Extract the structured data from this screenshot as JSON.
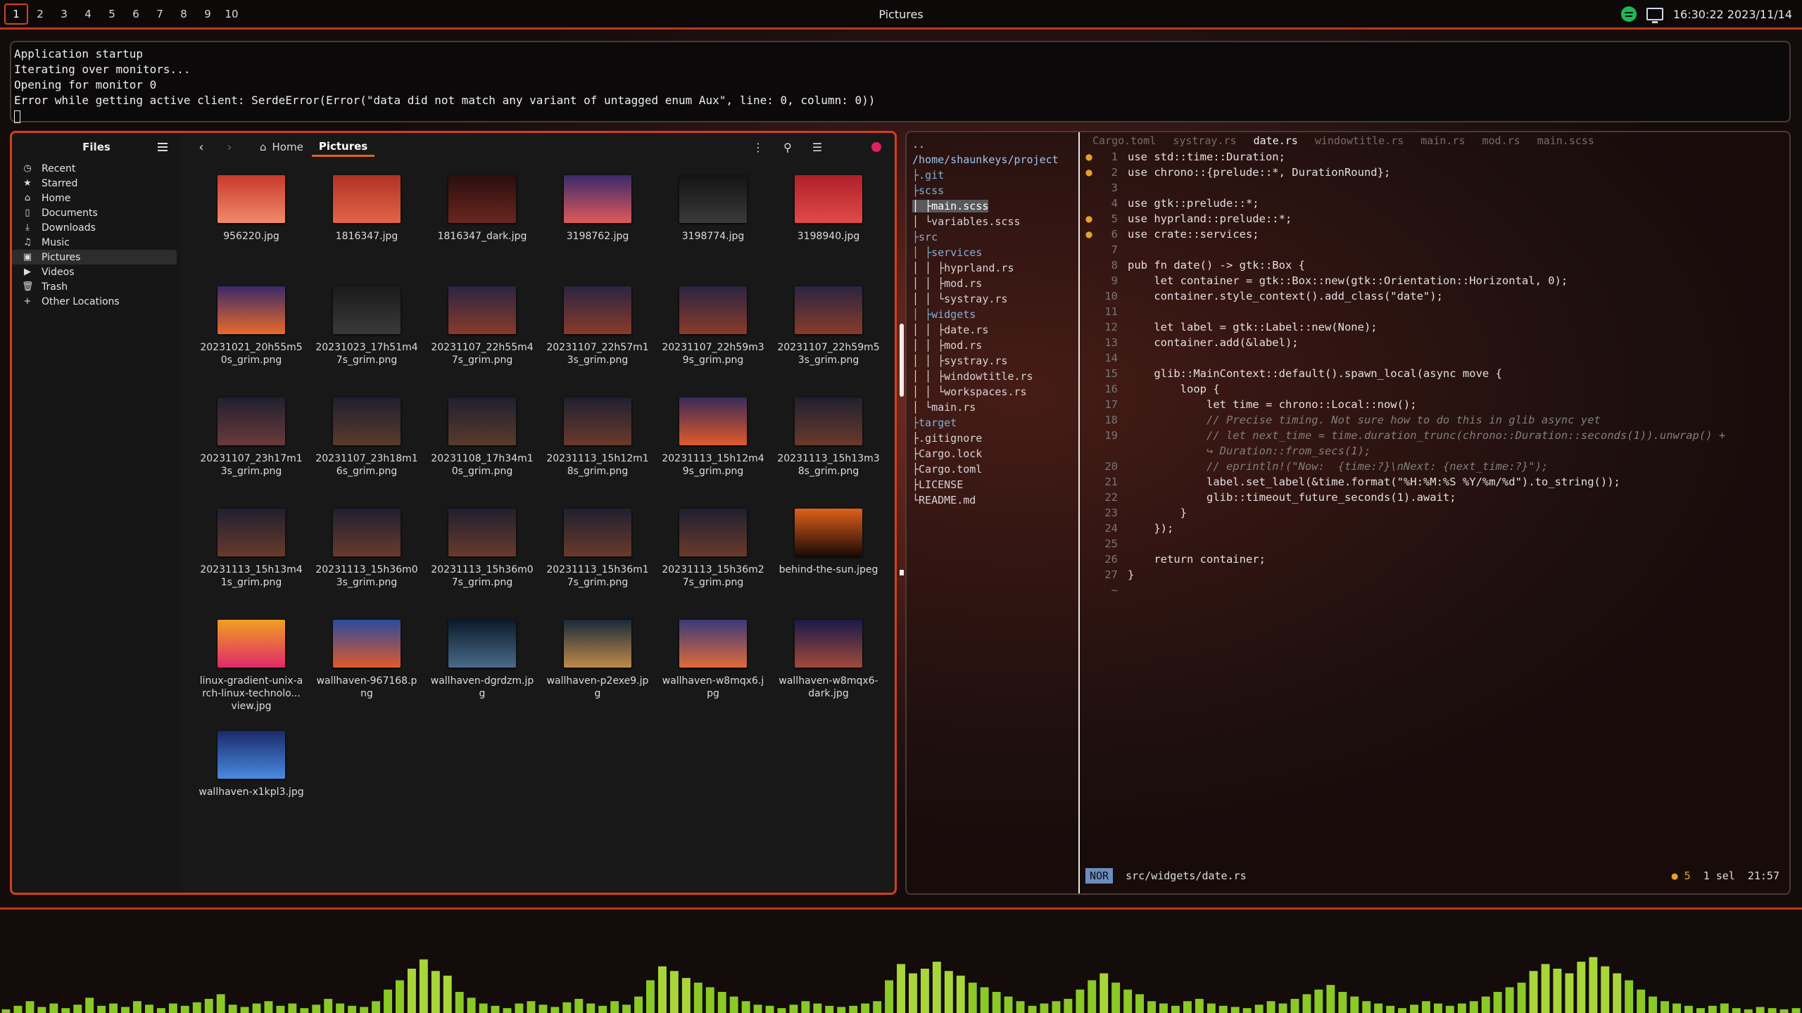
{
  "topbar": {
    "workspaces": [
      "1",
      "2",
      "3",
      "4",
      "5",
      "6",
      "7",
      "8",
      "9",
      "10"
    ],
    "active_workspace": "1",
    "title": "Pictures",
    "clock": "16:30:22 2023/11/14",
    "icons": [
      "spotify-icon",
      "monitor-icon"
    ]
  },
  "terminal": {
    "lines": [
      "Application startup",
      "Iterating over monitors...",
      "Opening for monitor 0",
      "Error while getting active client: SerdeError(Error(\"data did not match any variant of untagged enum Aux\", line: 0, column: 0))"
    ]
  },
  "files": {
    "sidebar_title": "Files",
    "places": [
      {
        "label": "Recent",
        "icon": "clock-icon"
      },
      {
        "label": "Starred",
        "icon": "star-icon"
      },
      {
        "label": "Home",
        "icon": "home-icon"
      },
      {
        "label": "Documents",
        "icon": "document-icon"
      },
      {
        "label": "Downloads",
        "icon": "download-icon"
      },
      {
        "label": "Music",
        "icon": "music-icon"
      },
      {
        "label": "Pictures",
        "icon": "picture-icon",
        "selected": true
      },
      {
        "label": "Videos",
        "icon": "video-icon"
      },
      {
        "label": "Trash",
        "icon": "trash-icon"
      },
      {
        "label": "Other Locations",
        "icon": "plus-icon"
      }
    ],
    "breadcrumb": {
      "home": "Home",
      "current": "Pictures"
    },
    "items": [
      {
        "name": "956220.jpg",
        "c1": "#c83a2c",
        "c2": "#f08a6a"
      },
      {
        "name": "1816347.jpg",
        "c1": "#b23224",
        "c2": "#e26448"
      },
      {
        "name": "1816347_dark.jpg",
        "c1": "#2a0e0e",
        "c2": "#6b2620"
      },
      {
        "name": "3198762.jpg",
        "c1": "#3a2a6a",
        "c2": "#e05a5a"
      },
      {
        "name": "3198774.jpg",
        "c1": "#141414",
        "c2": "#3a3a3a"
      },
      {
        "name": "3198940.jpg",
        "c1": "#b0202a",
        "c2": "#e04a4a"
      },
      {
        "name": "20231021_20h55m50s_grim.png",
        "c1": "#3a2a6a",
        "c2": "#e86a2a"
      },
      {
        "name": "20231023_17h51m47s_grim.png",
        "c1": "#1a1a1a",
        "c2": "#3a3a3a"
      },
      {
        "name": "20231107_22h55m47s_grim.png",
        "c1": "#2a2540",
        "c2": "#8a3a2a"
      },
      {
        "name": "20231107_22h57m13s_grim.png",
        "c1": "#2a2540",
        "c2": "#8a3a2a"
      },
      {
        "name": "20231107_22h59m39s_grim.png",
        "c1": "#2a2540",
        "c2": "#8a3a2a"
      },
      {
        "name": "20231107_22h59m53s_grim.png",
        "c1": "#2a2540",
        "c2": "#8a3a2a"
      },
      {
        "name": "20231107_23h17m13s_grim.png",
        "c1": "#202030",
        "c2": "#6a3a3a"
      },
      {
        "name": "20231107_23h18m16s_grim.png",
        "c1": "#202030",
        "c2": "#5a3a2a"
      },
      {
        "name": "20231108_17h34m10s_grim.png",
        "c1": "#202030",
        "c2": "#5a3a2a"
      },
      {
        "name": "20231113_15h12m18s_grim.png",
        "c1": "#202030",
        "c2": "#6a3a2a"
      },
      {
        "name": "20231113_15h12m49s_grim.png",
        "c1": "#3a2a5a",
        "c2": "#e05a2a"
      },
      {
        "name": "20231113_15h13m38s_grim.png",
        "c1": "#202030",
        "c2": "#6a3a2a"
      },
      {
        "name": "20231113_15h13m41s_grim.png",
        "c1": "#202030",
        "c2": "#6a3a2a"
      },
      {
        "name": "20231113_15h36m03s_grim.png",
        "c1": "#202030",
        "c2": "#6a3a2a"
      },
      {
        "name": "20231113_15h36m07s_grim.png",
        "c1": "#202030",
        "c2": "#6a3a2a"
      },
      {
        "name": "20231113_15h36m17s_grim.png",
        "c1": "#202030",
        "c2": "#6a3a2a"
      },
      {
        "name": "20231113_15h36m27s_grim.png",
        "c1": "#202030",
        "c2": "#6a3a2a"
      },
      {
        "name": "behind-the-sun.jpeg",
        "c1": "#e0601a",
        "c2": "#1a0a05"
      },
      {
        "name": "linux-gradient-unix-arch-linux-technolo... view.jpg",
        "c1": "#f0a020",
        "c2": "#e02a6a"
      },
      {
        "name": "wallhaven-967168.png",
        "c1": "#2a4aa0",
        "c2": "#e05a2a"
      },
      {
        "name": "wallhaven-dgrdzm.jpg",
        "c1": "#0a1a2a",
        "c2": "#4a6a8a"
      },
      {
        "name": "wallhaven-p2exe9.jpg",
        "c1": "#1a2a3a",
        "c2": "#c08a4a"
      },
      {
        "name": "wallhaven-w8mqx6.jpg",
        "c1": "#3a3a7a",
        "c2": "#e06a3a"
      },
      {
        "name": "wallhaven-w8mqx6-dark.jpg",
        "c1": "#1a1a4a",
        "c2": "#a04a3a"
      },
      {
        "name": "wallhaven-x1kpl3.jpg",
        "c1": "#1a2a6a",
        "c2": "#4a8ae0"
      }
    ]
  },
  "editor": {
    "tree": [
      {
        "text": "..",
        "type": "file"
      },
      {
        "text": "/home/shaunkeys/project",
        "type": "path"
      },
      {
        "text": "├.git",
        "type": "dir"
      },
      {
        "text": "├scss",
        "type": "dir"
      },
      {
        "text": "│ ├main.scss",
        "type": "file",
        "hl": true
      },
      {
        "text": "│ └variables.scss",
        "type": "file"
      },
      {
        "text": "├src",
        "type": "dir"
      },
      {
        "text": "│ ├services",
        "type": "dir"
      },
      {
        "text": "│ │ ├hyprland.rs",
        "type": "file"
      },
      {
        "text": "│ │ ├mod.rs",
        "type": "file"
      },
      {
        "text": "│ │ └systray.rs",
        "type": "file"
      },
      {
        "text": "│ ├widgets",
        "type": "dir"
      },
      {
        "text": "│ │ ├date.rs",
        "type": "file"
      },
      {
        "text": "│ │ ├mod.rs",
        "type": "file"
      },
      {
        "text": "│ │ ├systray.rs",
        "type": "file"
      },
      {
        "text": "│ │ ├windowtitle.rs",
        "type": "file"
      },
      {
        "text": "│ │ └workspaces.rs",
        "type": "file"
      },
      {
        "text": "│ └main.rs",
        "type": "file"
      },
      {
        "text": "├target",
        "type": "dir"
      },
      {
        "text": "├.gitignore",
        "type": "file"
      },
      {
        "text": "├Cargo.lock",
        "type": "file"
      },
      {
        "text": "├Cargo.toml",
        "type": "file"
      },
      {
        "text": "├LICENSE",
        "type": "file"
      },
      {
        "text": "└README.md",
        "type": "file"
      }
    ],
    "tabs": [
      {
        "label": "Cargo.toml"
      },
      {
        "label": "systray.rs"
      },
      {
        "label": "date.rs",
        "active": true
      },
      {
        "label": "windowtitle.rs"
      },
      {
        "label": "main.rs"
      },
      {
        "label": "mod.rs"
      },
      {
        "label": "main.scss"
      }
    ],
    "lines": [
      {
        "n": "1",
        "g": "●",
        "text": "use std::time::Duration;"
      },
      {
        "n": "2",
        "g": "●",
        "text": "use chrono::{prelude::*, DurationRound};"
      },
      {
        "n": "3",
        "g": "",
        "text": ""
      },
      {
        "n": "4",
        "g": "",
        "text": "use gtk::prelude::*;"
      },
      {
        "n": "5",
        "g": "●",
        "text": "use hyprland::prelude::*;"
      },
      {
        "n": "6",
        "g": "●",
        "text": "use crate::services;"
      },
      {
        "n": "7",
        "g": "",
        "text": ""
      },
      {
        "n": "8",
        "g": "",
        "text": "pub fn date() -> gtk::Box {"
      },
      {
        "n": "9",
        "g": "",
        "text": "    let container = gtk::Box::new(gtk::Orientation::Horizontal, 0);"
      },
      {
        "n": "10",
        "g": "",
        "text": "    container.style_context().add_class(\"date\");"
      },
      {
        "n": "11",
        "g": "",
        "text": ""
      },
      {
        "n": "12",
        "g": "",
        "text": "    let label = gtk::Label::new(None);"
      },
      {
        "n": "13",
        "g": "",
        "text": "    container.add(&label);"
      },
      {
        "n": "14",
        "g": "",
        "text": ""
      },
      {
        "n": "15",
        "g": "",
        "text": "    glib::MainContext::default().spawn_local(async move {"
      },
      {
        "n": "16",
        "g": "",
        "text": "        loop {"
      },
      {
        "n": "17",
        "g": "",
        "text": "            let time = chrono::Local::now();"
      },
      {
        "n": "18",
        "g": "",
        "text": "            // Precise timing. Not sure how to do this in glib async yet",
        "c": true
      },
      {
        "n": "19",
        "g": "",
        "text": "            // let next_time = time.duration_trunc(chrono::Duration::seconds(1)).unwrap() +",
        "c": true
      },
      {
        "n": "",
        "g": "",
        "text": "            ↪ Duration::from_secs(1);",
        "c": true
      },
      {
        "n": "20",
        "g": "",
        "text": "            // eprintln!(\"Now:  {time:?}\\nNext: {next_time:?}\");",
        "c": true
      },
      {
        "n": "21",
        "g": "",
        "text": "            label.set_label(&time.format(\"%H:%M:%S %Y/%m/%d\").to_string());"
      },
      {
        "n": "22",
        "g": "",
        "text": "            glib::timeout_future_seconds(1).await;"
      },
      {
        "n": "23",
        "g": "",
        "text": "        }"
      },
      {
        "n": "24",
        "g": "",
        "text": "    });"
      },
      {
        "n": "25",
        "g": "",
        "text": ""
      },
      {
        "n": "26",
        "g": "",
        "text": "    return container;"
      },
      {
        "n": "27",
        "g": "",
        "text": "}"
      },
      {
        "n": "~",
        "g": "",
        "text": ""
      }
    ],
    "status": {
      "mode": "NOR",
      "file": "src/widgets/date.rs",
      "diag": "● 5",
      "sel": "1 sel",
      "pos": "21:57"
    }
  },
  "visualizer": {
    "levels": [
      0.05,
      0.08,
      0.12,
      0.07,
      0.1,
      0.06,
      0.09,
      0.15,
      0.08,
      0.1,
      0.07,
      0.12,
      0.09,
      0.06,
      0.1,
      0.08,
      0.11,
      0.14,
      0.18,
      0.09,
      0.07,
      0.1,
      0.12,
      0.08,
      0.1,
      0.06,
      0.09,
      0.14,
      0.1,
      0.08,
      0.07,
      0.12,
      0.22,
      0.3,
      0.4,
      0.48,
      0.38,
      0.34,
      0.2,
      0.15,
      0.1,
      0.08,
      0.06,
      0.1,
      0.12,
      0.09,
      0.07,
      0.11,
      0.14,
      0.1,
      0.08,
      0.12,
      0.09,
      0.16,
      0.3,
      0.42,
      0.38,
      0.32,
      0.28,
      0.24,
      0.2,
      0.16,
      0.12,
      0.09,
      0.08,
      0.06,
      0.09,
      0.12,
      0.1,
      0.08,
      0.07,
      0.08,
      0.1,
      0.12,
      0.3,
      0.44,
      0.36,
      0.4,
      0.46,
      0.38,
      0.34,
      0.28,
      0.24,
      0.2,
      0.16,
      0.12,
      0.08,
      0.1,
      0.12,
      0.14,
      0.22,
      0.3,
      0.36,
      0.28,
      0.22,
      0.18,
      0.12,
      0.1,
      0.08,
      0.12,
      0.14,
      0.1,
      0.08,
      0.07,
      0.06,
      0.09,
      0.12,
      0.1,
      0.14,
      0.18,
      0.22,
      0.26,
      0.2,
      0.16,
      0.12,
      0.1,
      0.08,
      0.06,
      0.09,
      0.12,
      0.1,
      0.08,
      0.1,
      0.12,
      0.16,
      0.2,
      0.24,
      0.28,
      0.38,
      0.44,
      0.4,
      0.36,
      0.46,
      0.5,
      0.42,
      0.36,
      0.3,
      0.22,
      0.16,
      0.12,
      0.1,
      0.08,
      0.06,
      0.08,
      0.1,
      0.06,
      0.05,
      0.07,
      0.06,
      0.05,
      0.06
    ],
    "bar_color": "#8ac926"
  }
}
